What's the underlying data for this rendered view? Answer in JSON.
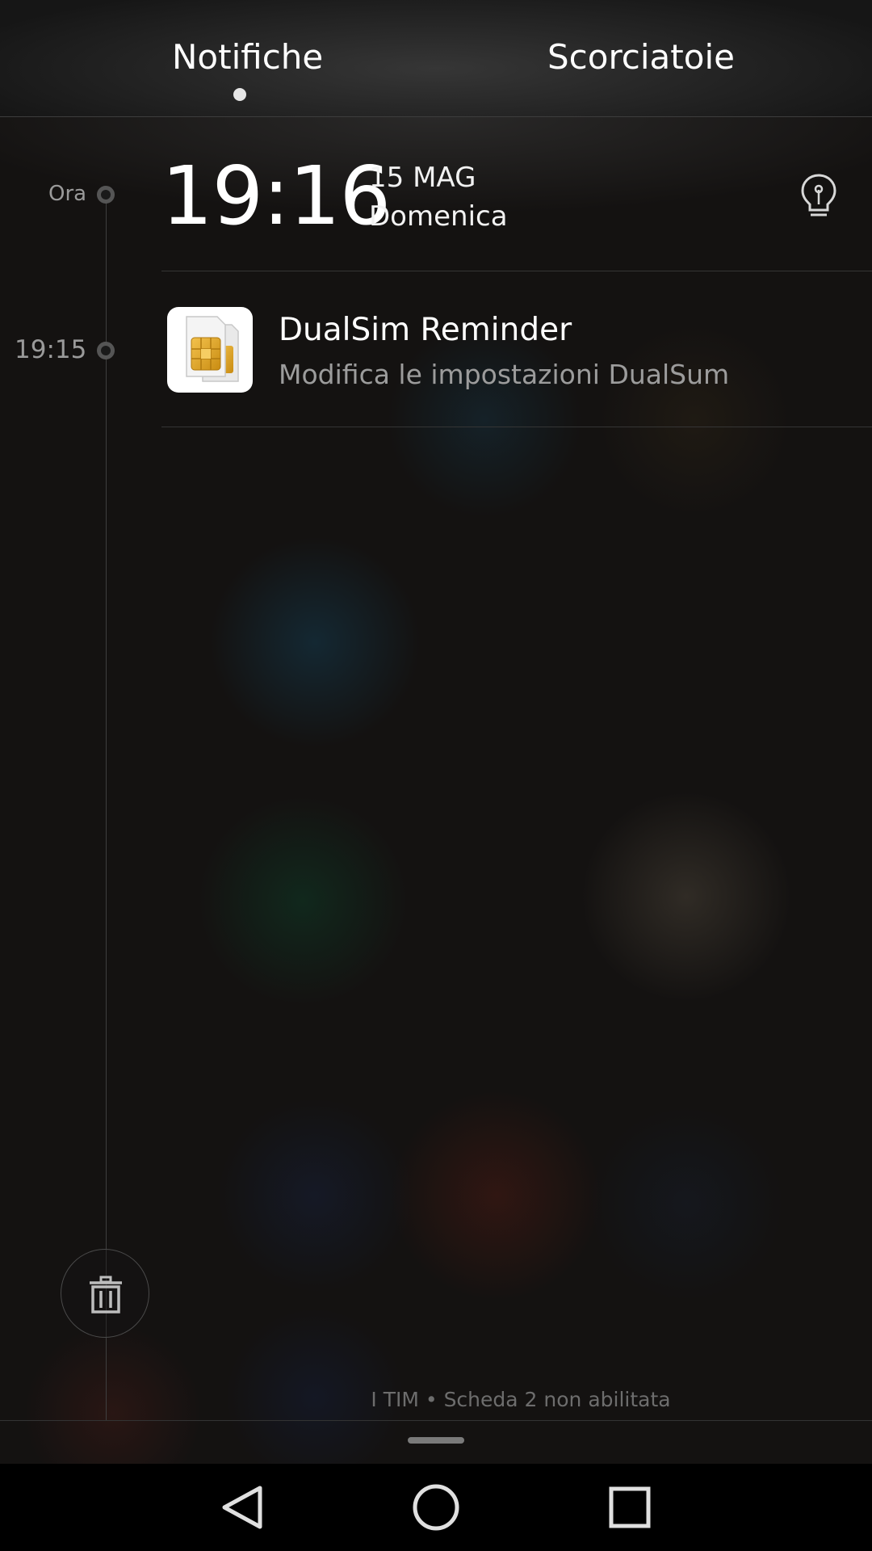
{
  "tabs": {
    "notifications_label": "Notifiche",
    "shortcuts_label": "Scorciatoie",
    "active": "Notifiche"
  },
  "timeline": {
    "now_label": "Ora",
    "clock_time": "19:16",
    "date_line": "15 MAG",
    "day_line": "Domenica",
    "tip_icon": "lightbulb-icon"
  },
  "notifications": [
    {
      "time": "19:15",
      "app_icon": "dual-sim-card-icon",
      "title": "DualSim Reminder",
      "body": "Modifica le impostazioni DualSum"
    }
  ],
  "footer": {
    "carrier_text": "I TIM • Scheda 2 non abilitata",
    "clear_icon": "trash-icon"
  },
  "navbar": {
    "back_icon": "back-triangle-icon",
    "home_icon": "home-circle-icon",
    "recents_icon": "recents-square-icon"
  },
  "colors": {
    "background": "#141211",
    "text_primary": "#ffffff",
    "text_secondary": "#9c9c9c",
    "sim_chip": "#e0a62a"
  }
}
